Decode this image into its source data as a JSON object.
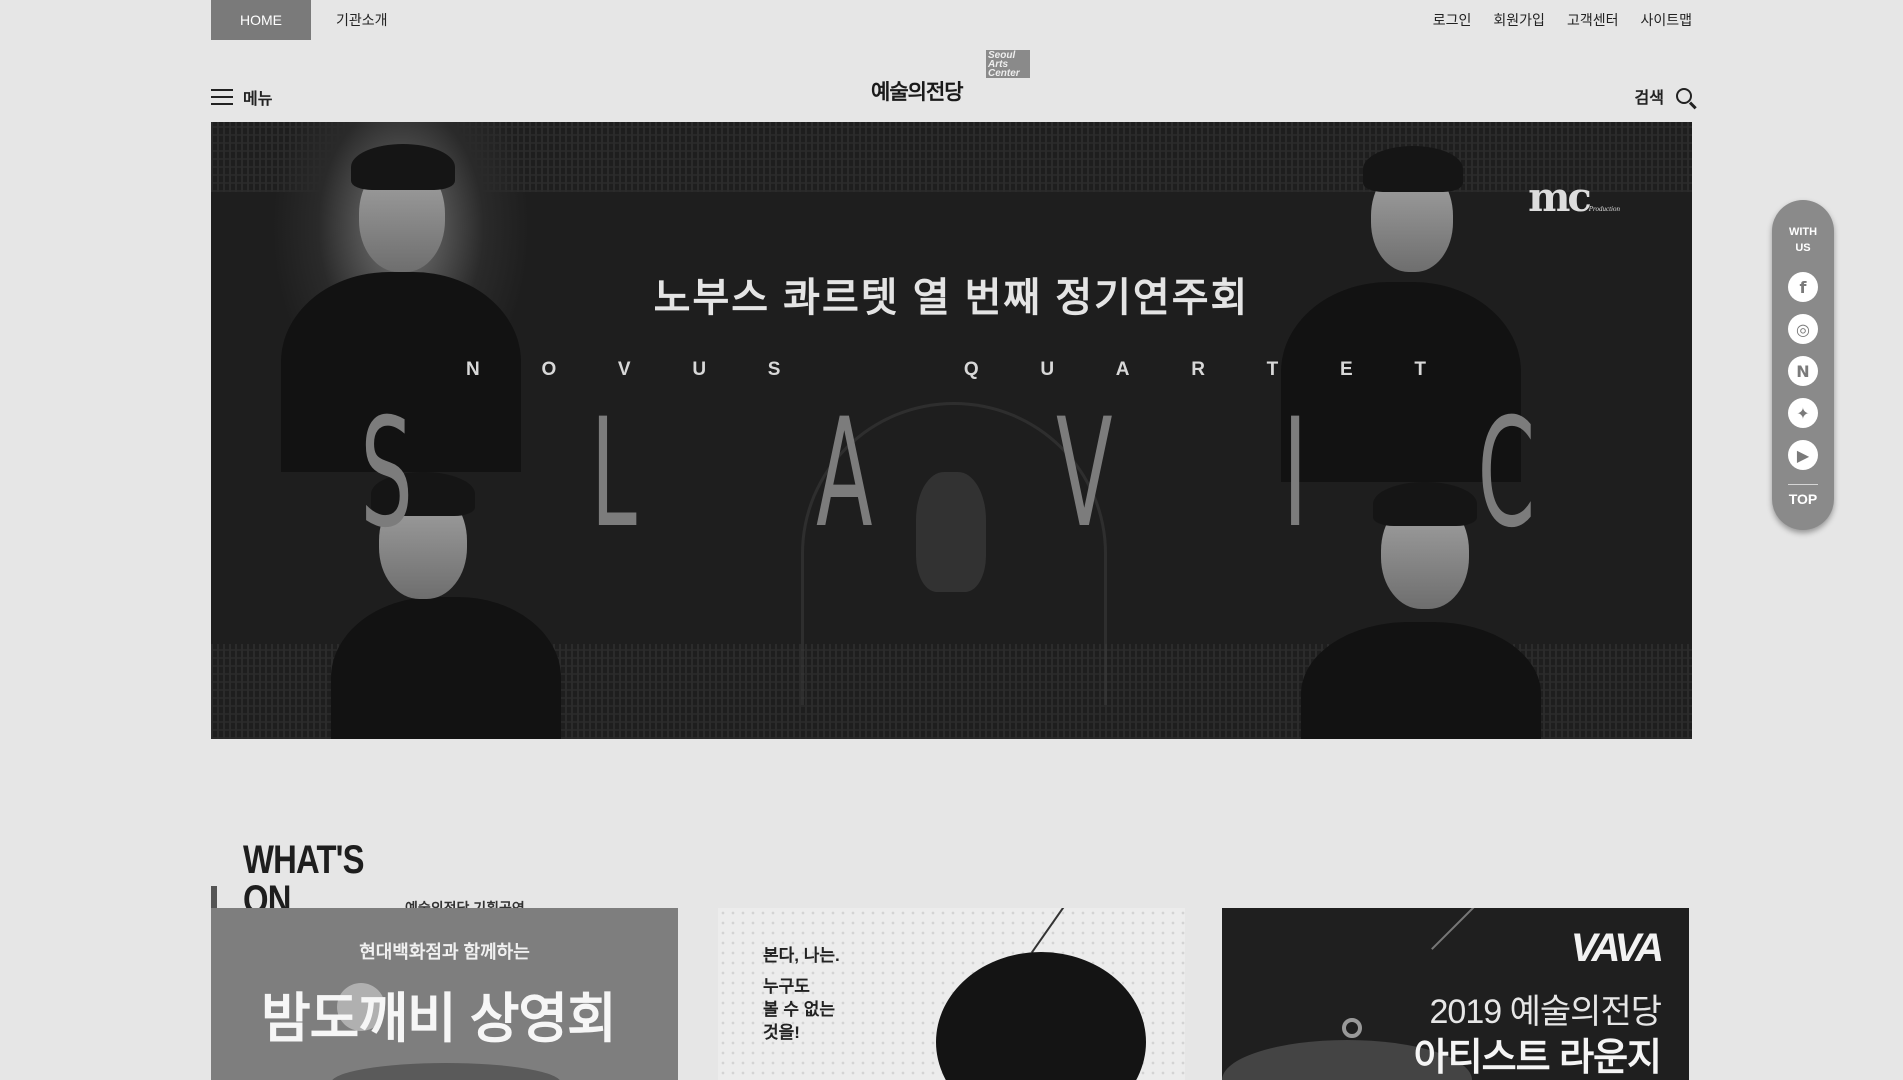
{
  "topbar": {
    "home_label": "HOME",
    "about_label": "기관소개",
    "utility_links": [
      "로그인",
      "회원가입",
      "고객센터",
      "사이트맵"
    ]
  },
  "header": {
    "menu_label": "메뉴",
    "logo_korean": "예술의전당",
    "logo_english": "Seoul Arts Center",
    "search_label": "검색"
  },
  "hero": {
    "title": "노부스 콰르텟   열 번째 정기연주회",
    "subtitle_word1": [
      "N",
      "O",
      "V",
      "U",
      "S"
    ],
    "subtitle_word2": [
      "Q",
      "U",
      "A",
      "R",
      "T",
      "E",
      "T"
    ],
    "big_letters": [
      "S",
      "L",
      "A",
      "V",
      "I",
      "C"
    ],
    "sponsor_logo": "mc",
    "sponsor_sub": "Production"
  },
  "side": {
    "with_label_1": "WITH",
    "with_label_2": "US",
    "sns": [
      {
        "name": "facebook-icon",
        "glyph": "f"
      },
      {
        "name": "instagram-icon",
        "glyph": "◎"
      },
      {
        "name": "naver-icon",
        "glyph": "N"
      },
      {
        "name": "twitter-icon",
        "glyph": "✦"
      },
      {
        "name": "youtube-icon",
        "glyph": "▶"
      }
    ],
    "top_label": "TOP"
  },
  "whats_on": {
    "title": "WHAT'S ON",
    "subtitle": "예술의전당 기획공연",
    "cards": [
      {
        "small": "현대백화점과 함께하는",
        "big": "밤도깨비 상영회"
      },
      {
        "lines": [
          "본다, 나는.",
          "",
          "누구도",
          "볼 수 없는",
          "것을!"
        ]
      },
      {
        "brand": "VAVA",
        "line1": "2019 예술의전당",
        "line2": "아티스트 라운지"
      }
    ]
  },
  "colors": {
    "background": "#e6e6e6",
    "home_tab": "#7a7a7a",
    "side_bar": "#8a8a8a",
    "hero_bg": "#1e1e1e"
  }
}
